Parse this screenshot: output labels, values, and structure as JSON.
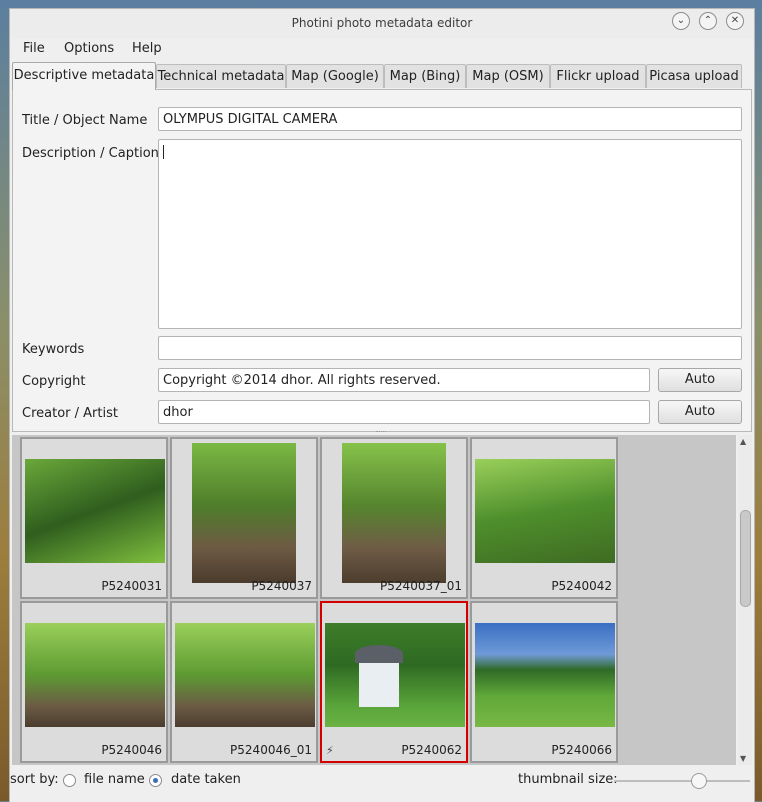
{
  "window": {
    "title": "Photini photo metadata editor"
  },
  "menu": [
    "File",
    "Options",
    "Help"
  ],
  "tabs": [
    {
      "label": "Descriptive metadata",
      "active": true
    },
    {
      "label": "Technical metadata",
      "active": false
    },
    {
      "label": "Map (Google)",
      "active": false
    },
    {
      "label": "Map (Bing)",
      "active": false
    },
    {
      "label": "Map (OSM)",
      "active": false
    },
    {
      "label": "Flickr upload",
      "active": false
    },
    {
      "label": "Picasa upload",
      "active": false
    }
  ],
  "form": {
    "title": {
      "label": "Title / Object Name",
      "value": "OLYMPUS DIGITAL CAMERA"
    },
    "description": {
      "label": "Description / Caption",
      "value": ""
    },
    "keywords": {
      "label": "Keywords",
      "value": ""
    },
    "copyright": {
      "label": "Copyright",
      "value": "Copyright ©2014 dhor. All rights reserved.",
      "button": "Auto"
    },
    "creator": {
      "label": "Creator / Artist",
      "value": "dhor",
      "button": "Auto"
    }
  },
  "thumbnails": [
    {
      "name": "P5240031",
      "orientation": "landscape",
      "selected": false,
      "flag": ""
    },
    {
      "name": "P5240037",
      "orientation": "portrait",
      "selected": false,
      "flag": ""
    },
    {
      "name": "P5240037_01",
      "orientation": "portrait",
      "selected": false,
      "flag": ""
    },
    {
      "name": "P5240042",
      "orientation": "landscape",
      "selected": false,
      "flag": ""
    },
    {
      "name": "P5240046",
      "orientation": "landscape",
      "selected": false,
      "flag": ""
    },
    {
      "name": "P5240046_01",
      "orientation": "landscape",
      "selected": false,
      "flag": ""
    },
    {
      "name": "P5240062",
      "orientation": "landscape",
      "selected": true,
      "flag": "⚡"
    },
    {
      "name": "P5240066",
      "orientation": "landscape",
      "selected": false,
      "flag": ""
    }
  ],
  "status": {
    "sort_label": "sort by:",
    "options": [
      {
        "label": "file name",
        "selected": false
      },
      {
        "label": "date taken",
        "selected": true
      }
    ],
    "thumb_label": "thumbnail size:",
    "thumb_size_fraction": 0.64
  },
  "colors": {
    "selection": "#d40000",
    "forest": "#4f8f2c",
    "sky": "#3a6fc2"
  }
}
